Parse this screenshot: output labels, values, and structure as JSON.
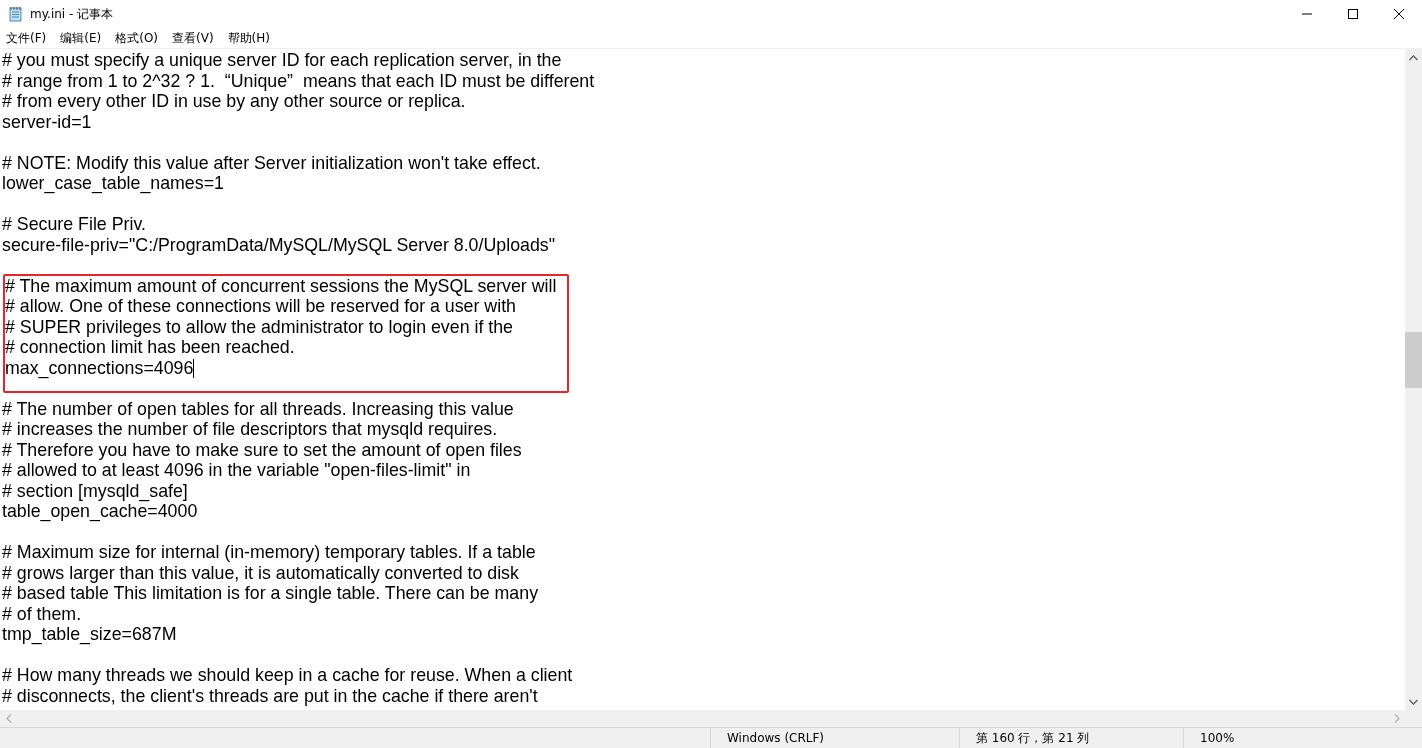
{
  "window": {
    "title": "my.ini - 记事本"
  },
  "menu": [
    {
      "label": "文件(F)"
    },
    {
      "label": "编辑(E)"
    },
    {
      "label": "格式(O)"
    },
    {
      "label": "查看(V)"
    },
    {
      "label": "帮助(H)"
    }
  ],
  "lines": [
    {
      "kind": "text",
      "text": "# you must specify a unique server ID for each replication server, in the",
      "cursor": false
    },
    {
      "kind": "text",
      "text": "# range from 1 to 2^32 ? 1.  “Unique”  means that each ID must be different",
      "cursor": false
    },
    {
      "kind": "text",
      "text": "# from every other ID in use by any other source or replica.",
      "cursor": false
    },
    {
      "kind": "text",
      "text": "server-id=1",
      "cursor": false
    },
    {
      "kind": "blank"
    },
    {
      "kind": "text",
      "text": "# NOTE: Modify this value after Server initialization won't take effect.",
      "cursor": false
    },
    {
      "kind": "text",
      "text": "lower_case_table_names=1",
      "cursor": false
    },
    {
      "kind": "blank"
    },
    {
      "kind": "text",
      "text": "# Secure File Priv.",
      "cursor": false
    },
    {
      "kind": "text",
      "text": "secure-file-priv=\"C:/ProgramData/MySQL/MySQL Server 8.0/Uploads\"",
      "cursor": false
    },
    {
      "kind": "blank"
    },
    {
      "kind": "box",
      "lines": [
        {
          "kind": "text",
          "text": "# The maximum amount of concurrent sessions the MySQL server will",
          "cursor": false
        },
        {
          "kind": "text",
          "text": "# allow. One of these connections will be reserved for a user with",
          "cursor": false
        },
        {
          "kind": "text",
          "text": "# SUPER privileges to allow the administrator to login even if the",
          "cursor": false
        },
        {
          "kind": "text",
          "text": "# connection limit has been reached.",
          "cursor": false
        },
        {
          "kind": "text",
          "text": "max_connections=4096",
          "cursor": true
        }
      ]
    },
    {
      "kind": "blank"
    },
    {
      "kind": "text",
      "text": "# The number of open tables for all threads. Increasing this value",
      "cursor": false
    },
    {
      "kind": "text",
      "text": "# increases the number of file descriptors that mysqld requires.",
      "cursor": false
    },
    {
      "kind": "text",
      "text": "# Therefore you have to make sure to set the amount of open files",
      "cursor": false
    },
    {
      "kind": "text",
      "text": "# allowed to at least 4096 in the variable \"open-files-limit\" in",
      "cursor": false
    },
    {
      "kind": "text",
      "text": "# section [mysqld_safe]",
      "cursor": false
    },
    {
      "kind": "text",
      "text": "table_open_cache=4000",
      "cursor": false
    },
    {
      "kind": "blank"
    },
    {
      "kind": "text",
      "text": "# Maximum size for internal (in-memory) temporary tables. If a table",
      "cursor": false
    },
    {
      "kind": "text",
      "text": "# grows larger than this value, it is automatically converted to disk",
      "cursor": false
    },
    {
      "kind": "text",
      "text": "# based table This limitation is for a single table. There can be many",
      "cursor": false
    },
    {
      "kind": "text",
      "text": "# of them.",
      "cursor": false
    },
    {
      "kind": "text",
      "text": "tmp_table_size=687M",
      "cursor": false
    },
    {
      "kind": "blank"
    },
    {
      "kind": "text",
      "text": "# How many threads we should keep in a cache for reuse. When a client",
      "cursor": false
    },
    {
      "kind": "text",
      "text": "# disconnects, the client's threads are put in the cache if there aren't",
      "cursor": false
    }
  ],
  "status_bar": [
    {
      "text": "Windows (CRLF)"
    },
    {
      "text": "第 160 行，第 21 列"
    },
    {
      "text": "100%"
    }
  ]
}
